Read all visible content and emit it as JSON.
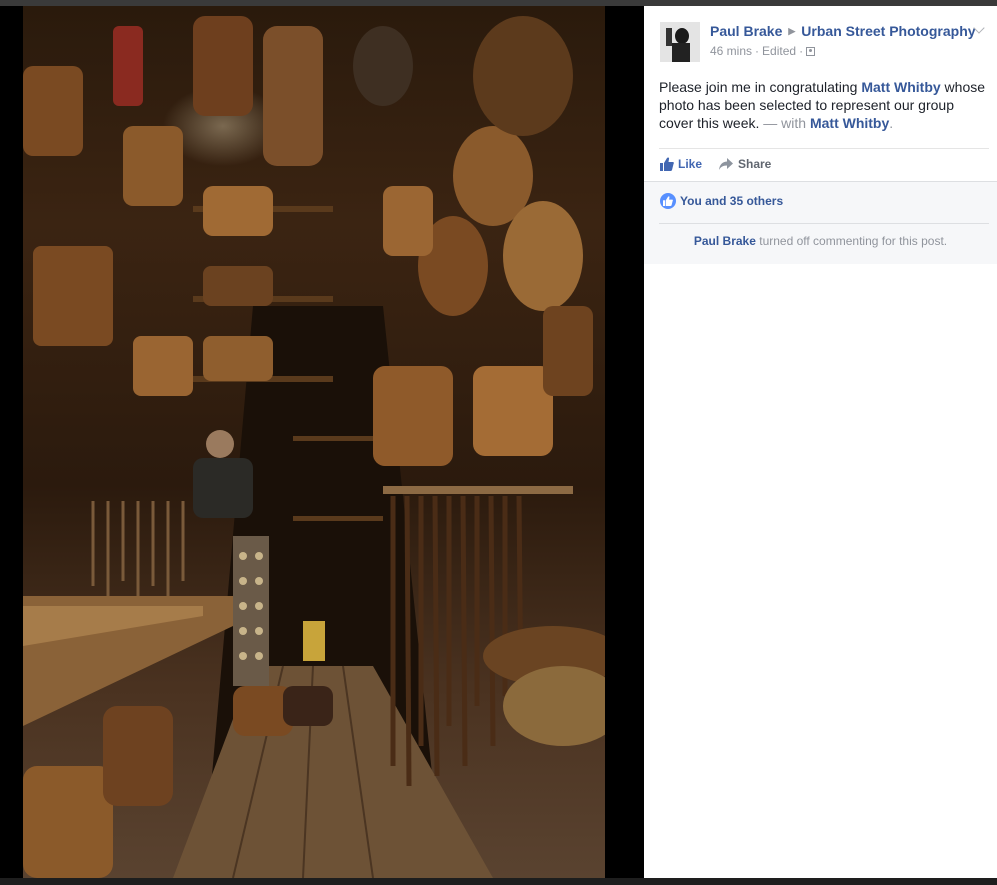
{
  "post": {
    "author": "Paul Brake",
    "group": "Urban Street Photography",
    "time": "46 mins",
    "edited": "Edited",
    "separator": "·",
    "text_before": "Please join me in congratulating ",
    "tagged_name": "Matt Whitby",
    "text_after": " whose photo has been selected to represent our group cover this week.",
    "with_prefix": " — with ",
    "with_name": "Matt Whitby",
    "period": "."
  },
  "actions": {
    "like_label": "Like",
    "share_label": "Share"
  },
  "reactions": {
    "summary": "You and 35 others"
  },
  "comments_notice": {
    "name": "Paul Brake",
    "text": " turned off commenting for this post."
  },
  "colors": {
    "link": "#365899",
    "like_blue": "#4267b2",
    "meta_gray": "#90949c",
    "badge_blue": "#5890ff"
  },
  "icons": [
    "like-thumb-icon",
    "share-arrow-icon",
    "audience-icon",
    "play-arrow-icon",
    "chevron-down-icon"
  ]
}
